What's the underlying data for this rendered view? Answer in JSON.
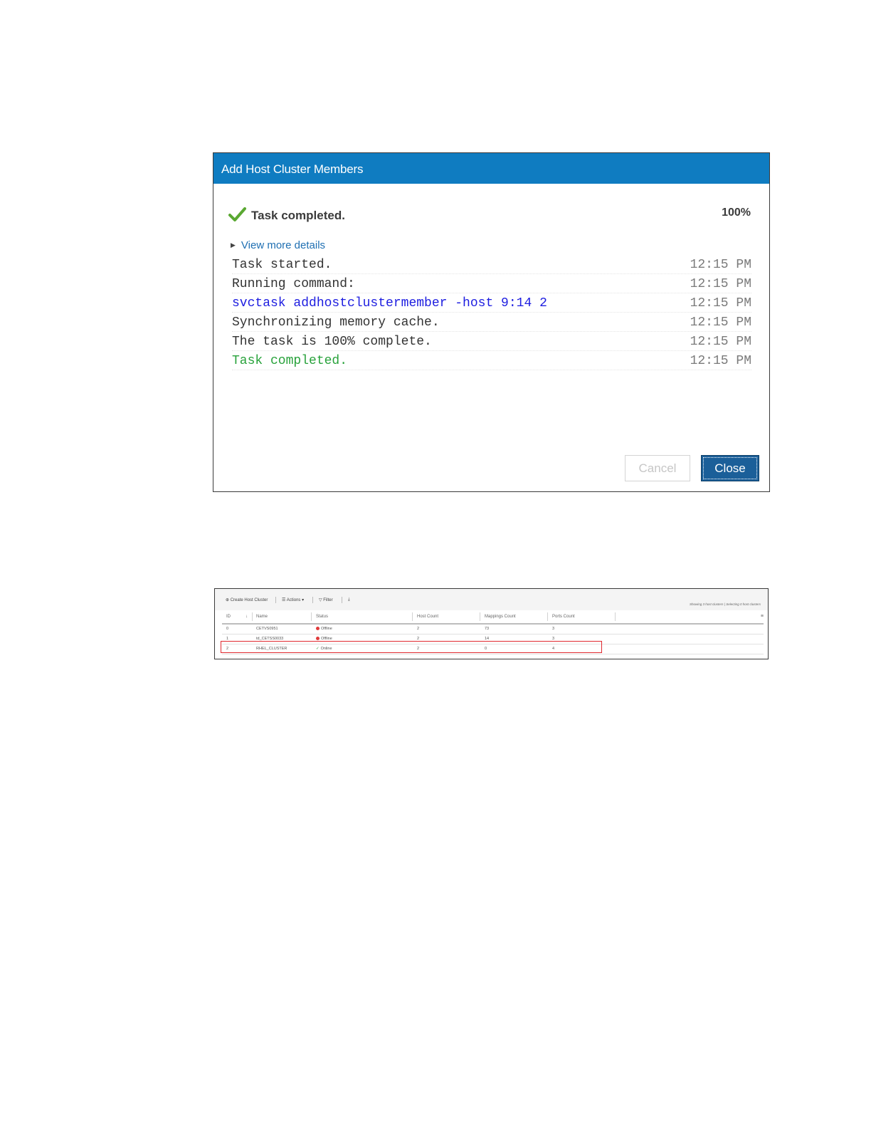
{
  "dialog": {
    "title": "Add Host Cluster Members",
    "status_text": "Task completed.",
    "progress_percent": "100%",
    "details_link": "View more details",
    "log": [
      {
        "message": "Task started.",
        "time": "12:15 PM",
        "kind": "normal"
      },
      {
        "message": "Running command:",
        "time": "12:15 PM",
        "kind": "normal"
      },
      {
        "message": "svctask addhostclustermember -host 9:14 2",
        "time": "12:15 PM",
        "kind": "command"
      },
      {
        "message": "Synchronizing memory cache.",
        "time": "12:15 PM",
        "kind": "normal"
      },
      {
        "message": "The task is 100% complete.",
        "time": "12:15 PM",
        "kind": "normal"
      },
      {
        "message": "Task completed.",
        "time": "12:15 PM",
        "kind": "done"
      }
    ],
    "cancel_label": "Cancel",
    "close_label": "Close",
    "colors": {
      "header": "#0f7cc1",
      "command": "#1d1de0",
      "success": "#28a23b",
      "close_button": "#1b5f99"
    }
  },
  "table_panel": {
    "toolbar": {
      "create_label": "Create Host Cluster",
      "actions_label": "Actions",
      "filter_label": "Filter",
      "showing_text": "Showing 3 host clusters | Selecting 0 host clusters"
    },
    "columns": [
      "ID",
      "Name",
      "Status",
      "Host Count",
      "Mappings Count",
      "Ports Count"
    ],
    "rows": [
      {
        "id": "0",
        "name": "CETVS0951",
        "status": "Offline",
        "host_count": "2",
        "mappings_count": "73",
        "ports_count": "3"
      },
      {
        "id": "1",
        "name": "td_CETSS0033",
        "status": "Offline",
        "host_count": "2",
        "mappings_count": "14",
        "ports_count": "3"
      },
      {
        "id": "2",
        "name": "RHEL_CLUSTER",
        "status": "Online",
        "host_count": "2",
        "mappings_count": "0",
        "ports_count": "4"
      }
    ],
    "highlighted_row": "RHEL_CLUSTER"
  }
}
